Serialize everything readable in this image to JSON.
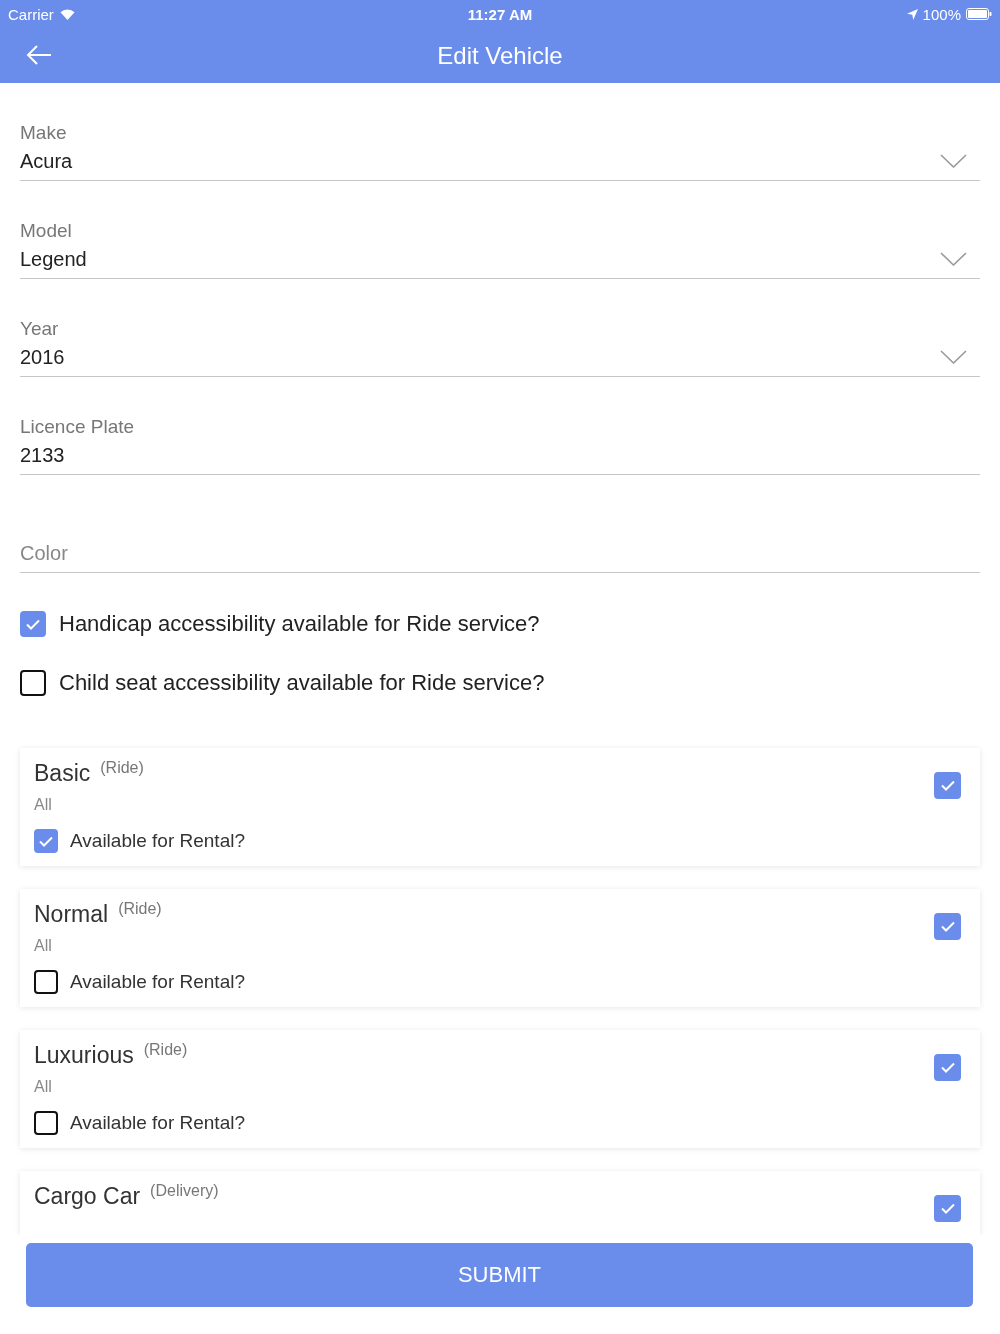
{
  "status_bar": {
    "carrier": "Carrier",
    "time": "11:27 AM",
    "battery": "100%"
  },
  "header": {
    "title": "Edit Vehicle"
  },
  "fields": [
    {
      "kind": "select",
      "label": "Make",
      "value": "Acura"
    },
    {
      "kind": "select",
      "label": "Model",
      "value": "Legend"
    },
    {
      "kind": "select",
      "label": "Year",
      "value": "2016"
    },
    {
      "kind": "text",
      "label": "Licence Plate",
      "value": "2133"
    },
    {
      "kind": "text",
      "placeholder": "Color"
    }
  ],
  "options": [
    {
      "label": "Handicap accessibility available for Ride service?",
      "checked": true
    },
    {
      "label": "Child seat accessibility available for Ride service?",
      "checked": false
    }
  ],
  "services": [
    {
      "name": "Basic",
      "type": "(Ride)",
      "scope": "All",
      "checked": true,
      "rental": {
        "label": "Available for Rental?",
        "checked": true
      }
    },
    {
      "name": "Normal",
      "type": "(Ride)",
      "scope": "All",
      "checked": true,
      "rental": {
        "label": "Available for Rental?",
        "checked": false
      }
    },
    {
      "name": "Luxurious",
      "type": "(Ride)",
      "scope": "All",
      "checked": true,
      "rental": {
        "label": "Available for Rental?",
        "checked": false
      }
    },
    {
      "name": "Cargo Car",
      "type": "(Delivery)",
      "checked": true
    }
  ],
  "submit_button": "SUBMIT"
}
